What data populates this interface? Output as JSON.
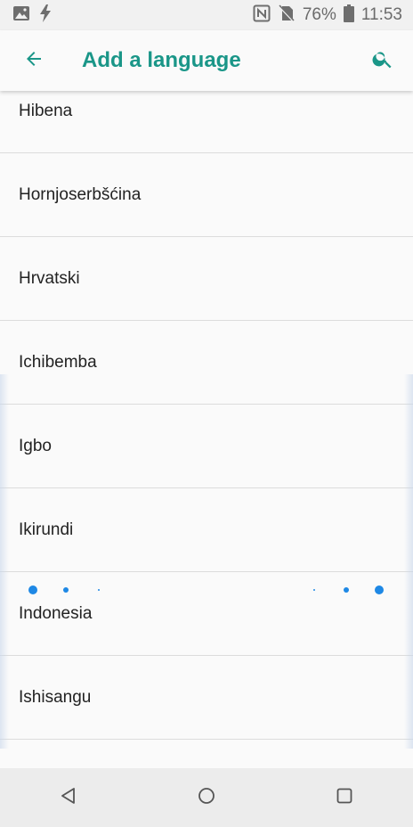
{
  "status_bar": {
    "battery_percent": "76%",
    "time": "11:53",
    "icons": [
      "image-icon",
      "flash-icon",
      "nfc-icon",
      "no-sim-icon",
      "battery-icon"
    ]
  },
  "app_bar": {
    "title": "Add a language",
    "accent_color": "#1a9688"
  },
  "languages": [
    "Hibena",
    "Hornjoserbšćina",
    "Hrvatski",
    "Ichibemba",
    "Igbo",
    "Ikirundi",
    "Indonesia",
    "Ishisangu"
  ],
  "nav_bar": {
    "icons": [
      "back-triangle-icon",
      "home-circle-icon",
      "recents-square-icon"
    ]
  },
  "loader_color": "#1e88e5"
}
